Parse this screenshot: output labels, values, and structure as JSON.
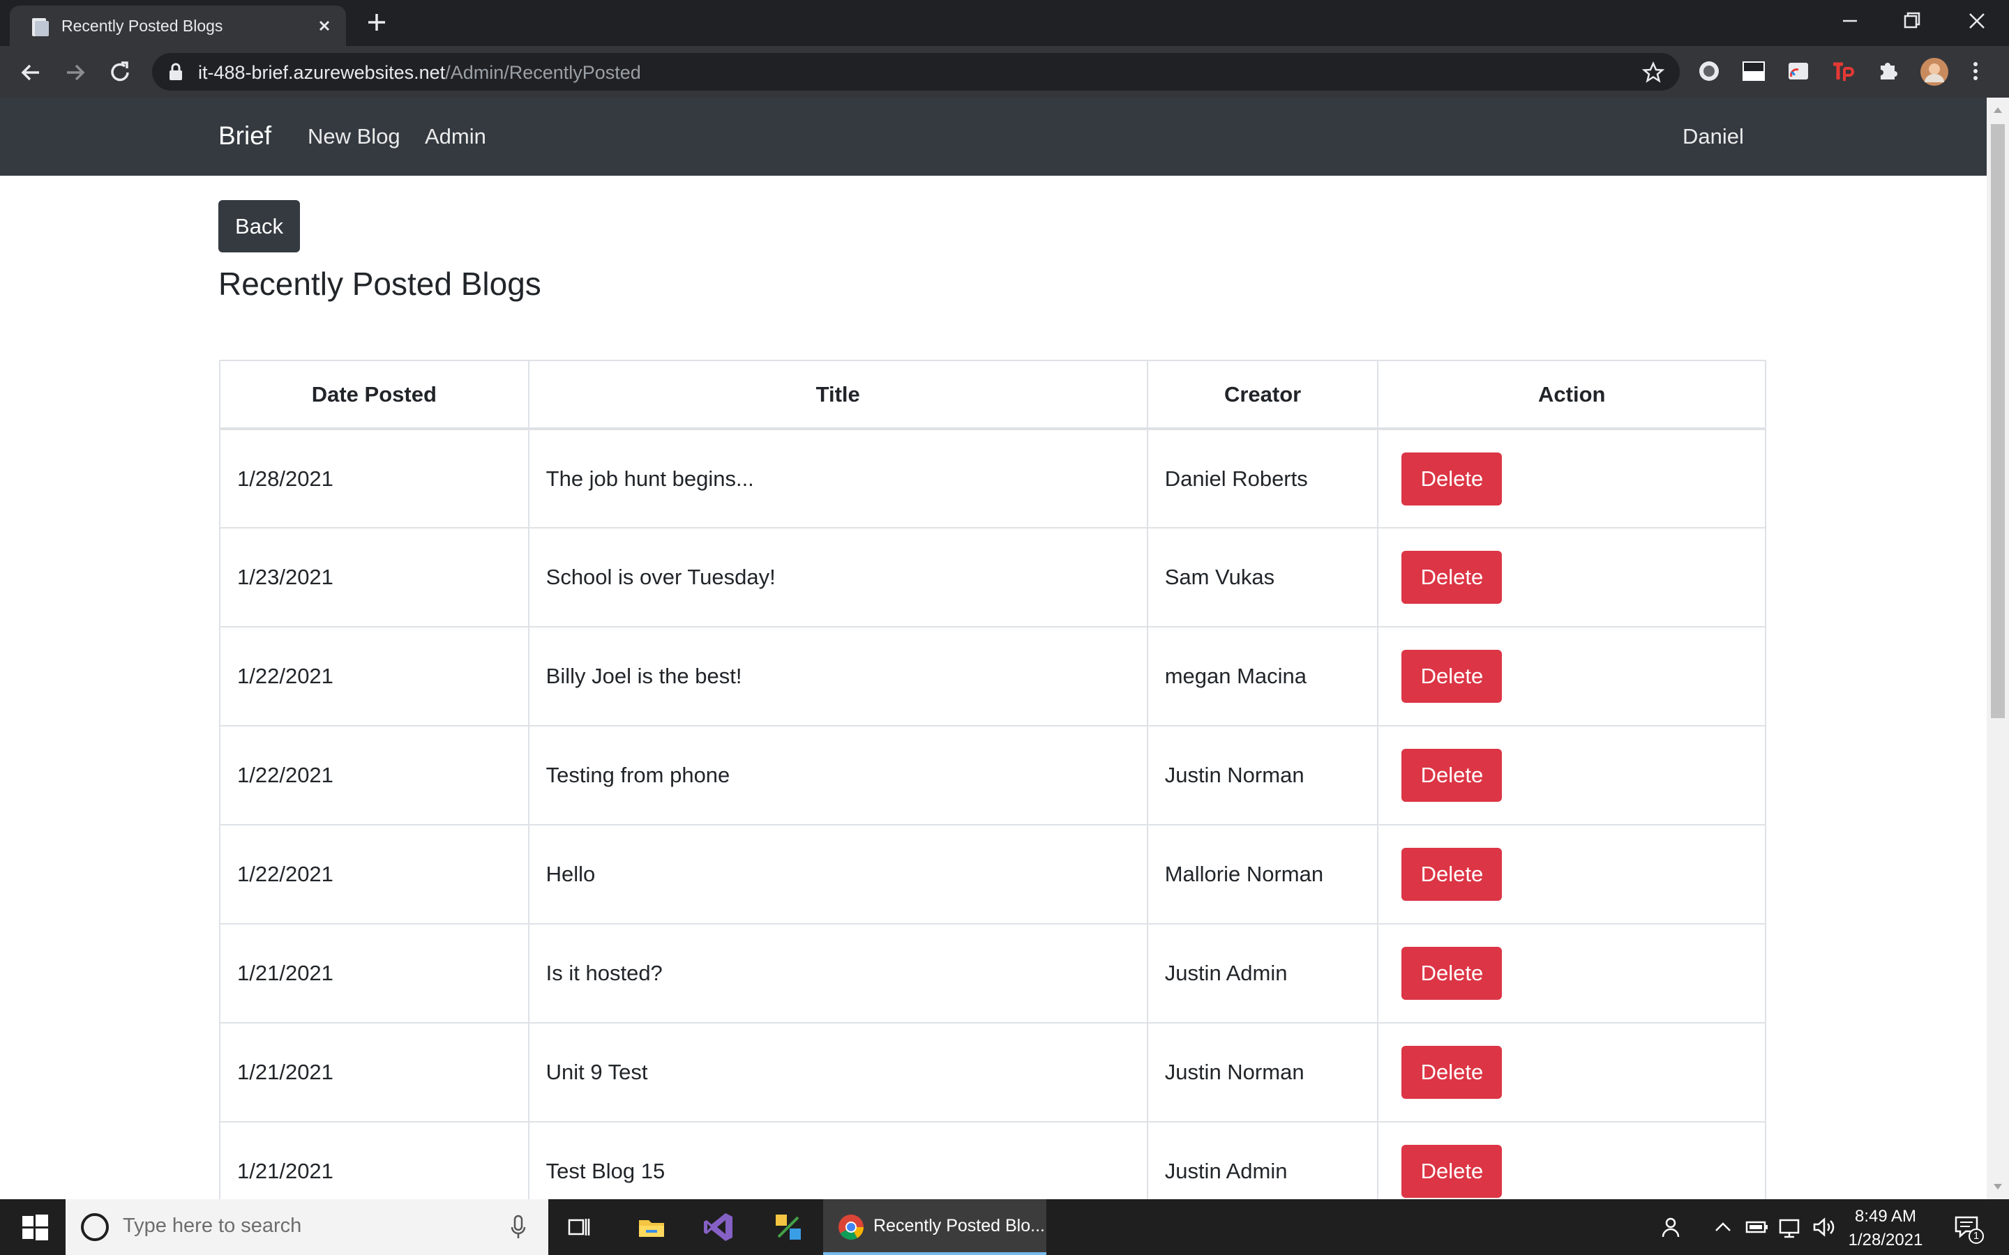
{
  "browser": {
    "tab_title": "Recently Posted Blogs",
    "url_host": "it-488-brief.azurewebsites.net",
    "url_path": "/Admin/RecentlyPosted"
  },
  "navbar": {
    "brand": "Brief",
    "links": [
      "New Blog",
      "Admin"
    ],
    "user": "Daniel"
  },
  "page": {
    "back_label": "Back",
    "title": "Recently Posted Blogs"
  },
  "table": {
    "headers": [
      "Date Posted",
      "Title",
      "Creator",
      "Action"
    ],
    "action_label": "Delete",
    "rows": [
      {
        "date": "1/28/2021",
        "title": "The job hunt begins...",
        "creator": "Daniel Roberts"
      },
      {
        "date": "1/23/2021",
        "title": "School is over Tuesday!",
        "creator": "Sam Vukas"
      },
      {
        "date": "1/22/2021",
        "title": "Billy Joel is the best!",
        "creator": "megan Macina"
      },
      {
        "date": "1/22/2021",
        "title": "Testing from phone",
        "creator": "Justin Norman"
      },
      {
        "date": "1/22/2021",
        "title": "Hello",
        "creator": "Mallorie Norman"
      },
      {
        "date": "1/21/2021",
        "title": "Is it hosted?",
        "creator": "Justin Admin"
      },
      {
        "date": "1/21/2021",
        "title": "Unit 9 Test",
        "creator": "Justin Norman"
      },
      {
        "date": "1/21/2021",
        "title": "Test Blog 15",
        "creator": "Justin Admin"
      }
    ]
  },
  "taskbar": {
    "search_placeholder": "Type here to search",
    "chrome_label": "Recently Posted Blo...",
    "time": "8:49 AM",
    "date": "1/28/2021",
    "notification_count": "1"
  },
  "colors": {
    "navbar_bg": "#343a40",
    "danger": "#dc3545",
    "chrome_dark": "#202124"
  }
}
